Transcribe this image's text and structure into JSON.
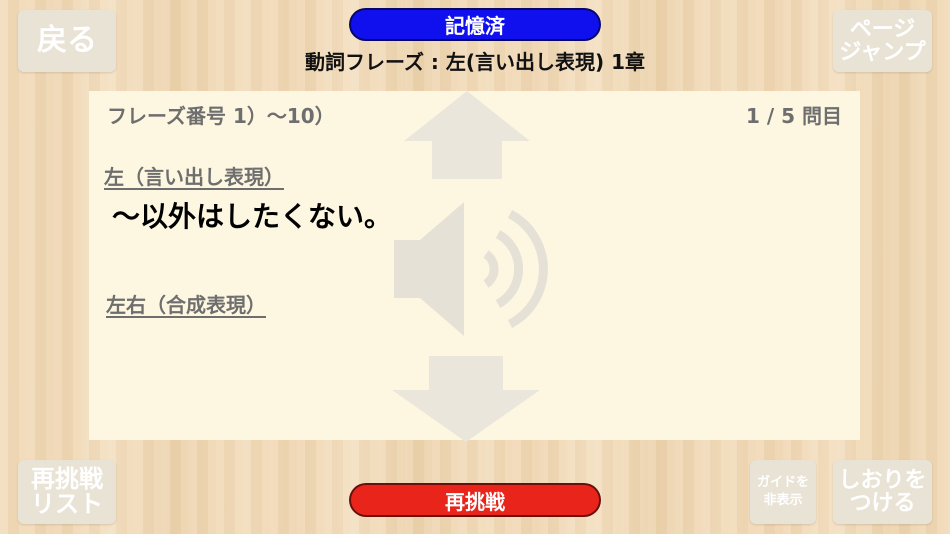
{
  "header": {
    "back_label": "戻る",
    "memorized_label": "記憶済",
    "chapter_title": "動詞フレーズ : 左(言い出し表現) 1章",
    "page_jump_line1": "ページ",
    "page_jump_line2": "ジャンプ"
  },
  "card": {
    "phrase_range": "フレーズ番号 1）〜10）",
    "progress": "1 / 5 問目",
    "category_1": "左（言い出し表現）",
    "main_phrase": "〜以外はしたくない。",
    "category_2": "左右（合成表現）"
  },
  "footer": {
    "retry_list_line1": "再挑戦",
    "retry_list_line2": "リスト",
    "retry_label": "再挑戦",
    "guide_line1": "ガイドを",
    "guide_line2": "非表示",
    "bookmark_line1": "しおりを",
    "bookmark_line2": "つける"
  },
  "colors": {
    "memorized_pill": "#1010ee",
    "retry_pill": "#e8241b",
    "card_background": "#fdf7e1",
    "button_background": "#e9e3d6"
  },
  "icons": {
    "up": "arrow-up-icon",
    "down": "arrow-down-icon",
    "audio": "speaker-icon"
  }
}
